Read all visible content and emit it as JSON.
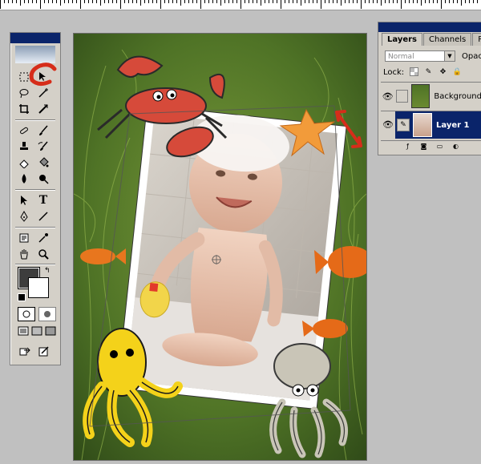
{
  "ruler": {
    "label": "horizontal-ruler"
  },
  "tools_palette": {
    "tools": [
      "marquee-tool",
      "move-tool",
      "lasso-tool",
      "magic-wand-tool",
      "crop-tool",
      "slice-tool",
      "healing-brush-tool",
      "brush-tool",
      "clone-stamp-tool",
      "history-brush-tool",
      "eraser-tool",
      "paint-bucket-tool",
      "blur-tool",
      "dodge-tool",
      "path-selection-tool",
      "type-tool",
      "pen-tool",
      "line-tool",
      "notes-tool",
      "eyedropper-tool",
      "hand-tool",
      "zoom-tool"
    ],
    "type_tool_glyph": "T",
    "foreground_color": "#3d3d3d",
    "background_color": "#ffffff"
  },
  "canvas": {
    "annotation_color": "#d62d1a",
    "background_color": "#4a6b2a"
  },
  "layers_panel": {
    "tabs": [
      {
        "label": "Layers",
        "active": true
      },
      {
        "label": "Channels",
        "active": false
      },
      {
        "label": "Pa",
        "active": false
      }
    ],
    "blend_mode": "Normal",
    "opacity_label": "Opac",
    "lock_label": "Lock:",
    "layers": [
      {
        "name": "Background",
        "selected": false,
        "visible": true
      },
      {
        "name": "Layer 1",
        "selected": true,
        "visible": true
      }
    ],
    "accent_color": "#0a246a"
  }
}
